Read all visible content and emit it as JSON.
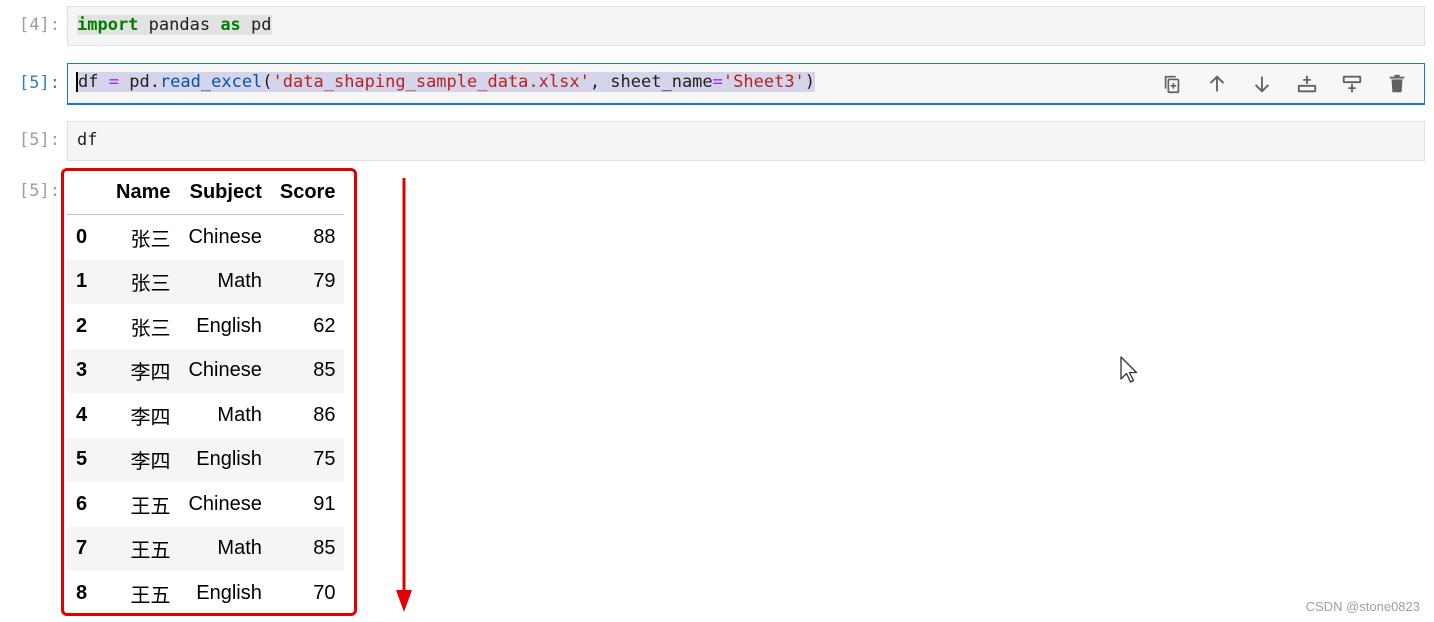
{
  "cells": [
    {
      "prompt": "[4]:",
      "tokens": [
        {
          "text": "import",
          "cls": "kw sel-g"
        },
        {
          "text": " pandas ",
          "cls": "sel-g"
        },
        {
          "text": "as",
          "cls": "kw sel-g"
        },
        {
          "text": " pd",
          "cls": "sel-g"
        }
      ]
    },
    {
      "prompt": "[5]:",
      "tokens": [
        {
          "text": "df",
          "cls": "sel cursor"
        },
        {
          "text": " ",
          "cls": "sel"
        },
        {
          "text": "=",
          "cls": "op sel"
        },
        {
          "text": " pd.",
          "cls": "sel"
        },
        {
          "text": "read_excel",
          "cls": "fn sel"
        },
        {
          "text": "(",
          "cls": "sel"
        },
        {
          "text": "'data_shaping_sample_data.xlsx'",
          "cls": "str sel"
        },
        {
          "text": ", sheet_name",
          "cls": "sel"
        },
        {
          "text": "=",
          "cls": "op sel"
        },
        {
          "text": "'Sheet3'",
          "cls": "str sel"
        },
        {
          "text": ")",
          "cls": "sel"
        }
      ]
    },
    {
      "prompt": "[5]:",
      "tokens": [
        {
          "text": "df",
          "cls": ""
        }
      ]
    }
  ],
  "output_prompt": "[5]:",
  "toolbar": [
    "duplicate-icon",
    "move-up-icon",
    "move-down-icon",
    "insert-above-icon",
    "insert-below-icon",
    "delete-icon"
  ],
  "table": {
    "columns": [
      "",
      "Name",
      "Subject",
      "Score"
    ],
    "rows": [
      [
        "0",
        "张三",
        "Chinese",
        "88"
      ],
      [
        "1",
        "张三",
        "Math",
        "79"
      ],
      [
        "2",
        "张三",
        "English",
        "62"
      ],
      [
        "3",
        "李四",
        "Chinese",
        "85"
      ],
      [
        "4",
        "李四",
        "Math",
        "86"
      ],
      [
        "5",
        "李四",
        "English",
        "75"
      ],
      [
        "6",
        "王五",
        "Chinese",
        "91"
      ],
      [
        "7",
        "王五",
        "Math",
        "85"
      ],
      [
        "8",
        "王五",
        "English",
        "70"
      ]
    ]
  },
  "annotation_color": "#e00000",
  "watermark": "CSDN @stone0823"
}
